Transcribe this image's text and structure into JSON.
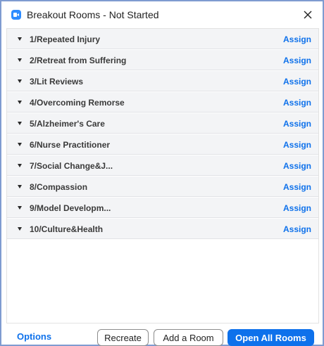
{
  "window": {
    "title": "Breakout Rooms - Not Started"
  },
  "icons": {
    "app": "zoom-camera-icon",
    "close": "close-icon",
    "expand": "caret-down-icon"
  },
  "rooms": [
    {
      "name": "1/Repeated Injury",
      "action": "Assign"
    },
    {
      "name": "2/Retreat from Suffering",
      "action": "Assign"
    },
    {
      "name": "3/Lit Reviews",
      "action": "Assign"
    },
    {
      "name": "4/Overcoming Remorse",
      "action": "Assign"
    },
    {
      "name": "5/Alzheimer's Care",
      "action": "Assign"
    },
    {
      "name": "6/Nurse Practitioner",
      "action": "Assign"
    },
    {
      "name": "7/Social Change&J...",
      "action": "Assign"
    },
    {
      "name": "8/Compassion",
      "action": "Assign"
    },
    {
      "name": "9/Model Developm...",
      "action": "Assign"
    },
    {
      "name": "10/Culture&Health",
      "action": "Assign"
    }
  ],
  "footer": {
    "options_label": "Options",
    "recreate_label": "Recreate",
    "add_room_label": "Add a Room",
    "open_all_label": "Open All Rooms"
  },
  "colors": {
    "accent": "#0e71eb",
    "row_background": "#f3f4f6",
    "window_border": "#7f9bd0"
  }
}
